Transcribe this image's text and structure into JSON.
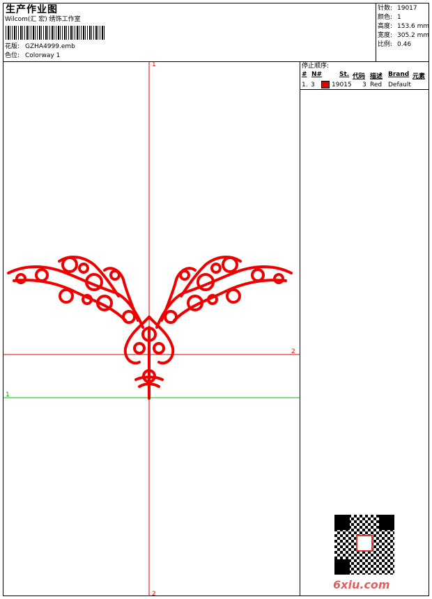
{
  "header": {
    "title": "生产作业图",
    "company": "Wilcom(汇 宏) 绣饰工作室",
    "design_label": "花版:",
    "design_value": "GZHA4999.emb",
    "colorway_label": "色位:",
    "colorway_value": "Colorway 1"
  },
  "stats": {
    "stitches_label": "针数:",
    "stitches_value": "19017",
    "colors_label": "颜色:",
    "colors_value": "1",
    "height_label": "高度:",
    "height_value": "153.6 mm",
    "width_label": "宽度:",
    "width_value": "305.2 mm",
    "scale_label": "比例:",
    "scale_value": "0.46"
  },
  "stop_sequence": {
    "title": "停止顺序:",
    "columns": [
      "#",
      "N#",
      "St.",
      "代码",
      "描述",
      "Brand",
      "元素"
    ],
    "rows": [
      {
        "index": "1.",
        "n": "3",
        "color": "#e00000",
        "stitches": "19015",
        "code": "3",
        "description": "Red",
        "brand": "Default",
        "element": ""
      }
    ]
  },
  "markers": {
    "v_top": "1",
    "v_bottom": "2",
    "h_red": "2",
    "h_green": "1"
  },
  "watermark": "6xiu.com",
  "colors": {
    "design": "#ee0000",
    "axis_red": "#e00000",
    "axis_green": "#00c000"
  }
}
